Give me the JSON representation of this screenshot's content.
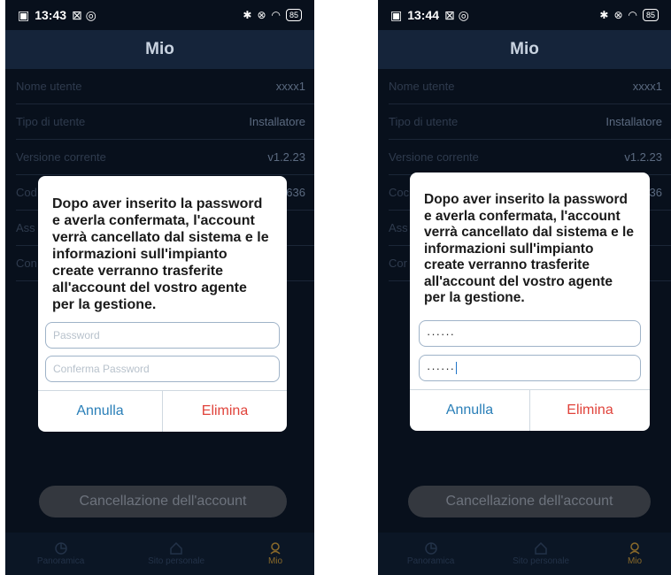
{
  "screens": [
    {
      "status": {
        "time": "13:43",
        "battery": "85"
      },
      "header": {
        "title": "Mio"
      },
      "rows": [
        {
          "label": "Nome utente",
          "value": "xxxx1"
        },
        {
          "label": "Tipo di utente",
          "value": "Installatore"
        },
        {
          "label": "Versione corrente",
          "value": "v1.2.23"
        },
        {
          "label": "Cod",
          "value": "636"
        },
        {
          "label": "Ass",
          "value": ""
        },
        {
          "label": "Con",
          "value": ""
        }
      ],
      "dialog": {
        "message": "Dopo aver inserito la password e averla confermata, l'account verrà cancellato dal sistema e le informazioni sull'impianto create verranno trasferite all'account del vostro agente per la gestione.",
        "password_placeholder": "Password",
        "confirm_placeholder": "Conferma Password",
        "password_value": "",
        "confirm_value": "",
        "cancel_label": "Annulla",
        "delete_label": "Elimina"
      },
      "delete_account_label": "Cancellazione dell'account",
      "tabs": [
        {
          "label": "Panoramica",
          "icon": "pie-chart-icon"
        },
        {
          "label": "Sito personale",
          "icon": "home-icon"
        },
        {
          "label": "Mio",
          "icon": "user-icon"
        }
      ]
    },
    {
      "status": {
        "time": "13:44",
        "battery": "85"
      },
      "header": {
        "title": "Mio"
      },
      "rows": [
        {
          "label": "Nome utente",
          "value": "xxxx1"
        },
        {
          "label": "Tipo di utente",
          "value": "Installatore"
        },
        {
          "label": "Versione corrente",
          "value": "v1.2.23"
        },
        {
          "label": "Coc",
          "value": "636"
        },
        {
          "label": "Ass",
          "value": ""
        },
        {
          "label": "Cor",
          "value": ""
        }
      ],
      "dialog": {
        "message": "Dopo aver inserito la password e averla confermata, l'account verrà cancellato dal sistema e le informazioni sull'impianto create verranno trasferite all'account del vostro agente per la gestione.",
        "password_placeholder": "Password",
        "confirm_placeholder": "Conferma Password",
        "password_value": "······",
        "confirm_value": "······",
        "cancel_label": "Annulla",
        "delete_label": "Elimina"
      },
      "delete_account_label": "Cancellazione dell'account",
      "tabs": [
        {
          "label": "Panoramica",
          "icon": "pie-chart-icon"
        },
        {
          "label": "Sito personale",
          "icon": "home-icon"
        },
        {
          "label": "Mio",
          "icon": "user-icon"
        }
      ]
    }
  ]
}
